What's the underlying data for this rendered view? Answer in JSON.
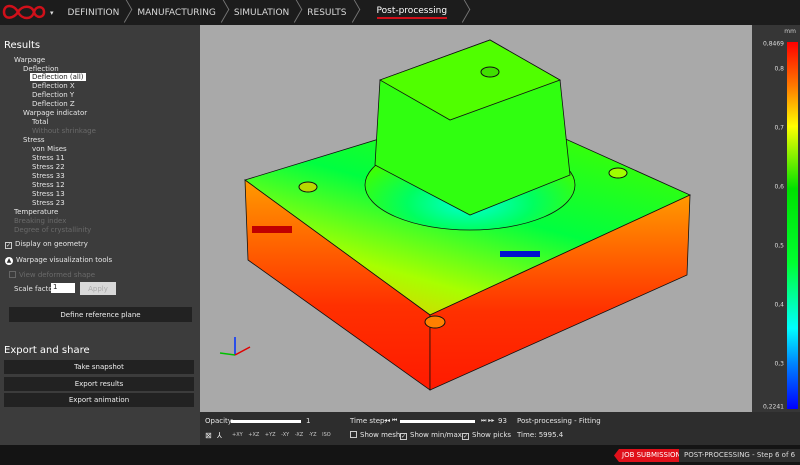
{
  "nav": {
    "items": [
      "DEFINITION",
      "MANUFACTURING",
      "SIMULATION",
      "RESULTS"
    ],
    "active": "Post-processing"
  },
  "results": {
    "title": "Results",
    "warpage": "Warpage",
    "deflection": "Deflection",
    "deflection_all": "Deflection (all)",
    "deflection_x": "Deflection X",
    "deflection_y": "Deflection Y",
    "deflection_z": "Deflection Z",
    "warpage_indicator": "Warpage indicator",
    "total": "Total",
    "without_shrinkage": "Without shrinkage",
    "stress": "Stress",
    "von_mises": "von Mises",
    "s11": "Stress 11",
    "s22": "Stress 22",
    "s33": "Stress 33",
    "s12": "Stress 12",
    "s13": "Stress 13",
    "s23": "Stress 23",
    "temperature": "Temperature",
    "breaking_index": "Breaking index",
    "crystallinity": "Degree of crystallinity"
  },
  "display_on_geometry": "Display on geometry",
  "warpage_tools": {
    "title": "Warpage visualization tools",
    "view_deformed": "View deformed shape",
    "scale_label": "Scale factor:",
    "scale_value": "1",
    "apply": "Apply",
    "define_plane": "Define reference plane"
  },
  "export": {
    "title": "Export and share",
    "snapshot": "Take snapshot",
    "results": "Export results",
    "animation": "Export animation"
  },
  "legend": {
    "unit": "mm",
    "max": "0,8469",
    "min": "0,2241",
    "ticks": [
      "0,8",
      "0,7",
      "0,6",
      "0,5",
      "0,4",
      "0,3"
    ]
  },
  "toolbar": {
    "opacity_label": "Opacity:",
    "opacity_value": "1",
    "timestep_label": "Time step:",
    "timestep_value": "93",
    "show_mesh": "Show mesh",
    "show_minmax": "Show min/max",
    "show_picks": "Show picks",
    "info_title": "Post-processing - Fitting",
    "info_time": "Time: 5995.4",
    "view_buttons": [
      "+XY",
      "+XZ",
      "+YZ",
      "-XY",
      "-XZ",
      "-YZ",
      "ISO"
    ]
  },
  "status": {
    "job_submission": "JOB SUBMISSION",
    "step": "POST-PROCESSING - Step 6 of 6"
  }
}
